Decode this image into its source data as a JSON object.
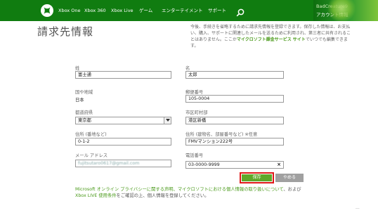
{
  "nav": {
    "items": [
      "Xbox One",
      "Xbox 360",
      "Xbox Live",
      "ゲーム",
      "エンターテイメント",
      "サポート"
    ],
    "brand_color": "#107c10"
  },
  "account": {
    "gamertag": "BadCreature9",
    "label": "アカウント情報"
  },
  "page": {
    "title": "請求先情報",
    "intro_text": "今後、手続きを省略するために請求先情報を登録できます。保存した情報は、お支払い、購入、サポートに関連したメールを送るために利用され、第三者に共有されることはありません。ここか",
    "intro_link": "マイクロソフト課金サービス サイト",
    "intro_tail": "でいつでも編集できます。"
  },
  "form": {
    "last_name_label": "姓",
    "last_name_value": "富士通",
    "first_name_label": "名",
    "first_name_value": "太郎",
    "country_label": "国や地域",
    "country_value": "日本",
    "postal_label": "郵便番号",
    "postal_value": "105-0004",
    "prefecture_label": "都道府県",
    "prefecture_value": "東京都",
    "city_label": "市区町村部",
    "city_value": "港区新橋",
    "address1_label": "住所 (番地など)",
    "address1_value": "0-1-2",
    "address2_label": "住所 (建物名、部屋番号など) ※任意",
    "address2_value": "FMVマンション222号",
    "email_label": "メール アドレス",
    "email_value": "fujitsutaro0617@gmail.com",
    "phone_label": "電話番号",
    "phone_value": "03-0000-9999"
  },
  "buttons": {
    "save_label": "保存",
    "cancel_label": "やめる"
  },
  "footer": {
    "privacy_link1": "Microsoft オンライン プライバシーに関する声明、マイクロソフトにおける個人情報の取り扱いについて",
    "privacy_mid": "、および",
    "privacy_link2": "Xbox LIVE 使用条件",
    "privacy_tail": "をご確認の上、個人情報を登録してください。"
  },
  "icons": [
    "xbox-logo-icon",
    "search-icon",
    "chevron-down-icon",
    "clear-icon"
  ]
}
